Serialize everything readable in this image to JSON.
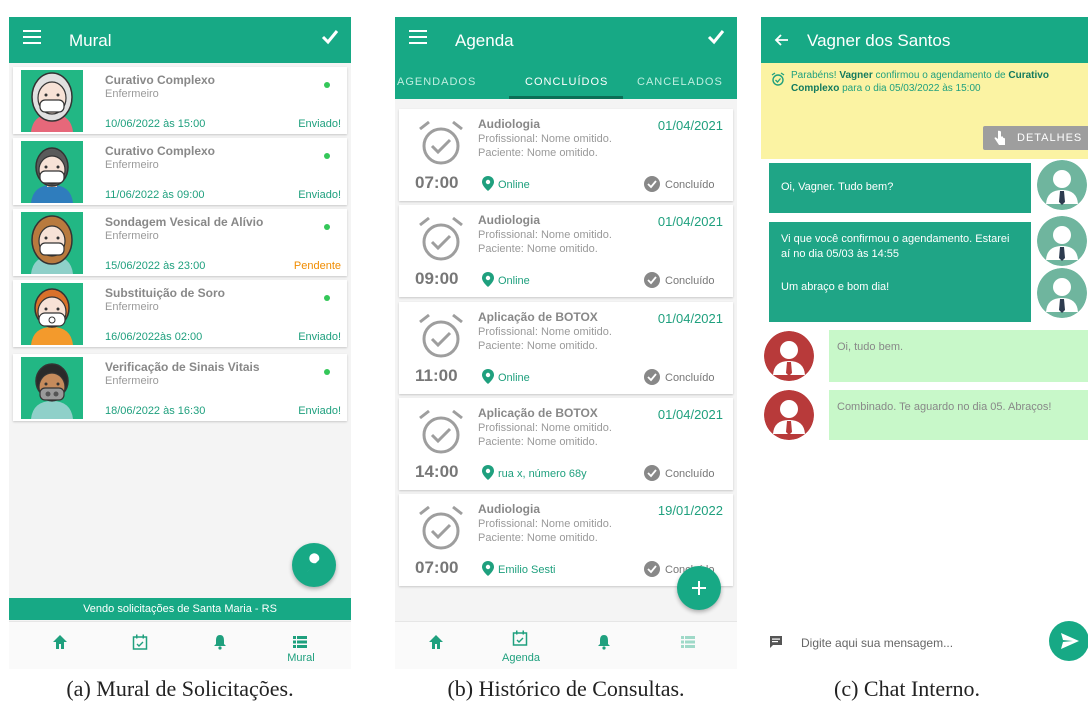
{
  "captions": [
    "(a) Mural de Solicitações.",
    "(b) Histórico de Consultas.",
    "(c) Chat Interno."
  ],
  "colors": {
    "primary": "#17a985",
    "text_green": "#1fa07e",
    "pending": "#f08c00",
    "notice_bg": "#fbf3a3",
    "incoming_bubble": "#c8f8c9"
  },
  "mural": {
    "title": "Mural",
    "cards": [
      {
        "title": "Curativo Complexo",
        "role": "Enfermeiro",
        "datetime": "10/06/2022 às 15:00",
        "status": "Enviado!"
      },
      {
        "title": "Curativo Complexo",
        "role": "Enfermeiro",
        "datetime": "11/06/2022 às 09:00",
        "status": "Enviado!"
      },
      {
        "title": "Sondagem Vesical de Alívio",
        "role": "Enfermeiro",
        "datetime": "15/06/2022 às 23:00",
        "status": "Pendente"
      },
      {
        "title": "Substituição de Soro",
        "role": "Enfermeiro",
        "datetime": "16/06/2022às 02:00",
        "status": "Enviado!"
      },
      {
        "title": "Verificação de Sinais Vitais",
        "role": "Enfermeiro",
        "datetime": "18/06/2022 às 16:30",
        "status": "Enviado!"
      }
    ],
    "footer": "Vendo solicitações de Santa Maria - RS",
    "nav": {
      "active_label": "Mural"
    }
  },
  "agenda": {
    "title": "Agenda",
    "tabs": [
      "AGENDADOS",
      "CONCLUÍDOS",
      "CANCELADOS"
    ],
    "cards": [
      {
        "title": "Audiologia",
        "professional": "Profissional: Nome omitido.",
        "patient": "Paciente: Nome omitido.",
        "date": "01/04/2021",
        "time": "07:00",
        "location": "Online",
        "status": "Concluído"
      },
      {
        "title": "Audiologia",
        "professional": "Profissional: Nome omitido.",
        "patient": "Paciente: Nome omitido.",
        "date": "01/04/2021",
        "time": "09:00",
        "location": "Online",
        "status": "Concluído"
      },
      {
        "title": "Aplicação de BOTOX",
        "professional": "Profissional: Nome omitido.",
        "patient": "Paciente: Nome omitido.",
        "date": "01/04/2021",
        "time": "11:00",
        "location": "Online",
        "status": "Concluído"
      },
      {
        "title": "Aplicação de BOTOX",
        "professional": "Profissional: Nome omitido.",
        "patient": "Paciente: Nome omitido.",
        "date": "01/04/2021",
        "time": "14:00",
        "location": "rua x, número 68y",
        "status": "Concluído"
      },
      {
        "title": "Audiologia",
        "professional": "Profissional: Nome omitido.",
        "patient": "Paciente: Nome omitido.",
        "date": "19/01/2022",
        "time": "07:00",
        "location": "Emilio Sesti",
        "status": "Concluído"
      }
    ],
    "nav": {
      "active_label": "Agenda"
    }
  },
  "chat": {
    "title": "Vagner dos Santos",
    "notice": {
      "p1": "Parabéns! ",
      "b1": "Vagner",
      "p2": " confirmou o agendamento de ",
      "b2": "Curativo Complexo",
      "p3": " para o dia 05/03/2022 às 15:00"
    },
    "details_label": "DETALHES",
    "messages_out": [
      "Oi, Vagner. Tudo bem?",
      "Vi que você confirmou o agendamento. Estarei aí no dia 05/03 às 14:55",
      "Um abraço e bom dia!"
    ],
    "messages_in": [
      "Oi, tudo bem.",
      "Combinado. Te aguardo no dia 05. Abraços!"
    ],
    "input_placeholder": "Digite aqui sua mensagem..."
  }
}
